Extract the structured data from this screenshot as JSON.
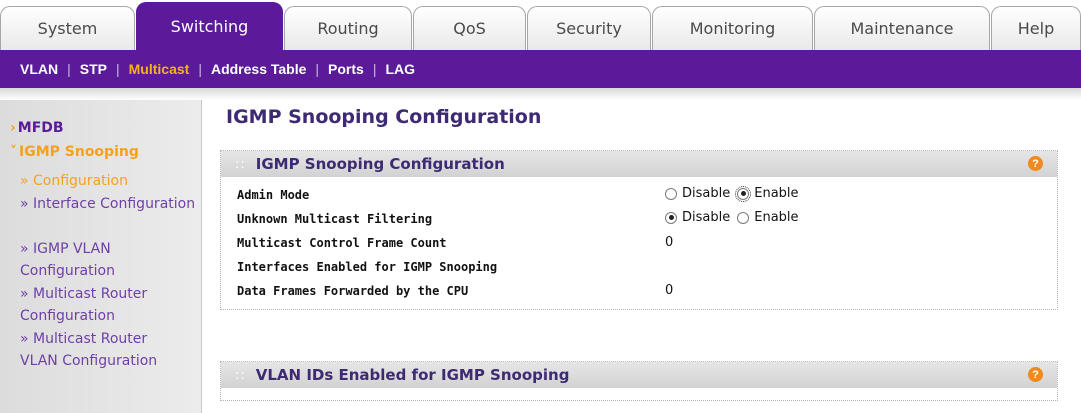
{
  "tabs": [
    {
      "label": "System"
    },
    {
      "label": "Switching",
      "active": true
    },
    {
      "label": "Routing"
    },
    {
      "label": "QoS"
    },
    {
      "label": "Security"
    },
    {
      "label": "Monitoring"
    },
    {
      "label": "Maintenance"
    },
    {
      "label": "Help"
    }
  ],
  "subnav": {
    "items": [
      "VLAN",
      "STP",
      "Multicast",
      "Address Table",
      "Ports",
      "LAG"
    ],
    "active": "Multicast",
    "separator": "|"
  },
  "sidebar": {
    "mfdb": "MFDB",
    "igmp_snooping": "IGMP Snooping",
    "items": [
      "» Configuration",
      "» Interface Configuration",
      "» IGMP VLAN Configuration",
      "» Multicast Router Configuration",
      "» Multicast Router VLAN Configuration"
    ]
  },
  "page": {
    "title": "IGMP Snooping Configuration"
  },
  "panel1": {
    "title": "IGMP Snooping Configuration",
    "help": "?",
    "rows": {
      "admin_mode": {
        "label": "Admin Mode",
        "disable": "Disable",
        "enable": "Enable",
        "selected": "Enable"
      },
      "unknown_multicast": {
        "label": "Unknown Multicast Filtering",
        "disable": "Disable",
        "enable": "Enable",
        "selected": "Disable"
      },
      "control_frame_count": {
        "label": "Multicast Control Frame Count",
        "value": "0"
      },
      "interfaces_enabled": {
        "label": "Interfaces Enabled for IGMP Snooping",
        "value": ""
      },
      "data_frames": {
        "label": "Data Frames Forwarded by the CPU",
        "value": "0"
      }
    }
  },
  "panel2": {
    "title": "VLAN IDs Enabled for IGMP Snooping",
    "help": "?"
  },
  "colors": {
    "brand_purple": "#5a1a99",
    "accent_orange": "#f5a11c",
    "title_purple": "#3d2a72"
  }
}
